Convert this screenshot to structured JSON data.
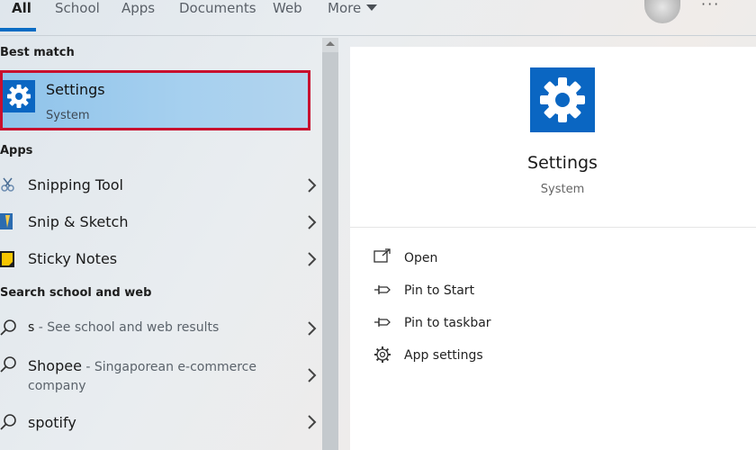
{
  "tabs": {
    "items": [
      "All",
      "School",
      "Apps",
      "Documents",
      "Web",
      "More"
    ]
  },
  "best_match": {
    "heading": "Best match",
    "title": "Settings",
    "subtitle": "System"
  },
  "apps": {
    "heading": "Apps",
    "items": [
      "Snipping Tool",
      "Snip & Sketch",
      "Sticky Notes"
    ]
  },
  "web": {
    "heading": "Search school and web",
    "items": [
      {
        "label": "s",
        "sub": " - See school and web results"
      },
      {
        "label": "Shopee",
        "sub": " - Singaporean e-commerce",
        "sub2": "company"
      },
      {
        "label": "spotify",
        "sub": ""
      }
    ]
  },
  "detail": {
    "title": "Settings",
    "subtitle": "System",
    "actions": [
      "Open",
      "Pin to Start",
      "Pin to taskbar",
      "App settings"
    ]
  },
  "colors": {
    "accent": "#0a66c2",
    "highlight_border": "#c8102e"
  }
}
